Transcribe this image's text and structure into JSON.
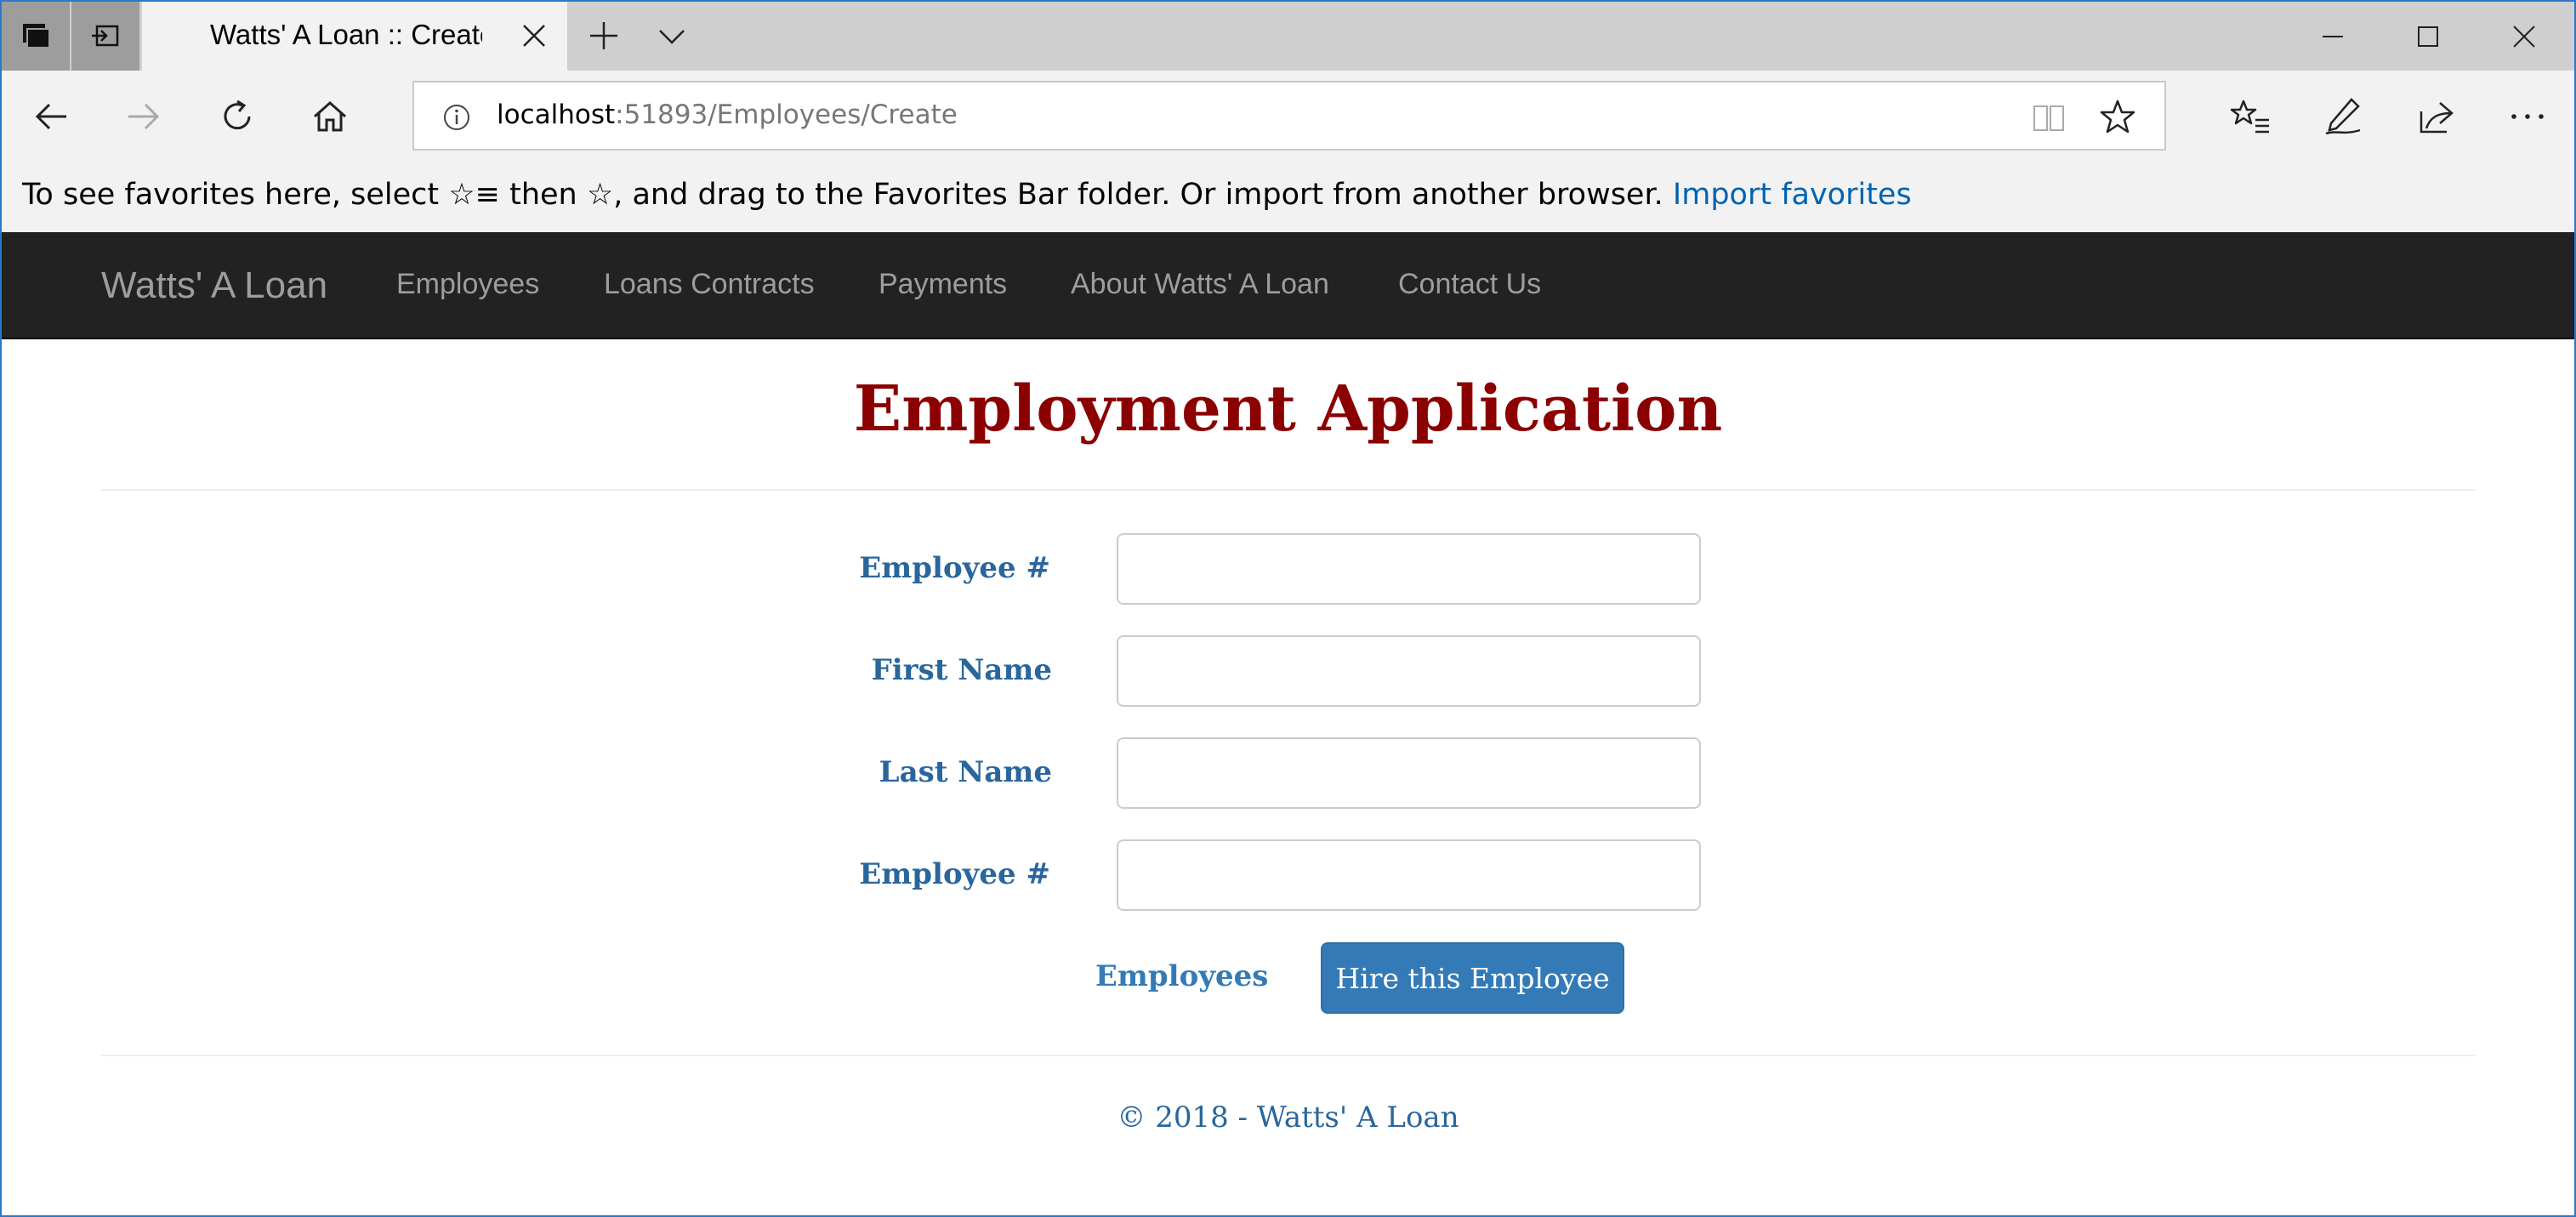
{
  "browser": {
    "tab_title": "Watts' A Loan :: Create E",
    "url_host": "localhost",
    "url_path": ":51893/Employees/Create",
    "favorites_hint_before": "To see favorites here, select ",
    "favorites_hint_icon": "☆≡",
    "favorites_hint_after": " then ☆, and drag to the Favorites Bar folder. Or import from another browser. ",
    "favorites_hint_link": "Import favorites"
  },
  "navbar": {
    "brand": "Watts' A Loan",
    "links": [
      "Employees",
      "Loans Contracts",
      "Payments",
      "About Watts' A Loan",
      "Contact Us"
    ]
  },
  "page": {
    "title": "Employment Application",
    "fields": [
      {
        "label": "Employee #",
        "value": ""
      },
      {
        "label": "First Name",
        "value": ""
      },
      {
        "label": "Last Name",
        "value": ""
      },
      {
        "label": "Employee #",
        "value": ""
      }
    ],
    "back_link": "Employees",
    "submit_label": "Hire this Employee",
    "footer": "© 2018 - Watts' A Loan"
  },
  "colors": {
    "title": "#8b0000",
    "label": "#29669d",
    "button": "#337ab7",
    "navbar": "#222222",
    "link": "#0063b1"
  }
}
